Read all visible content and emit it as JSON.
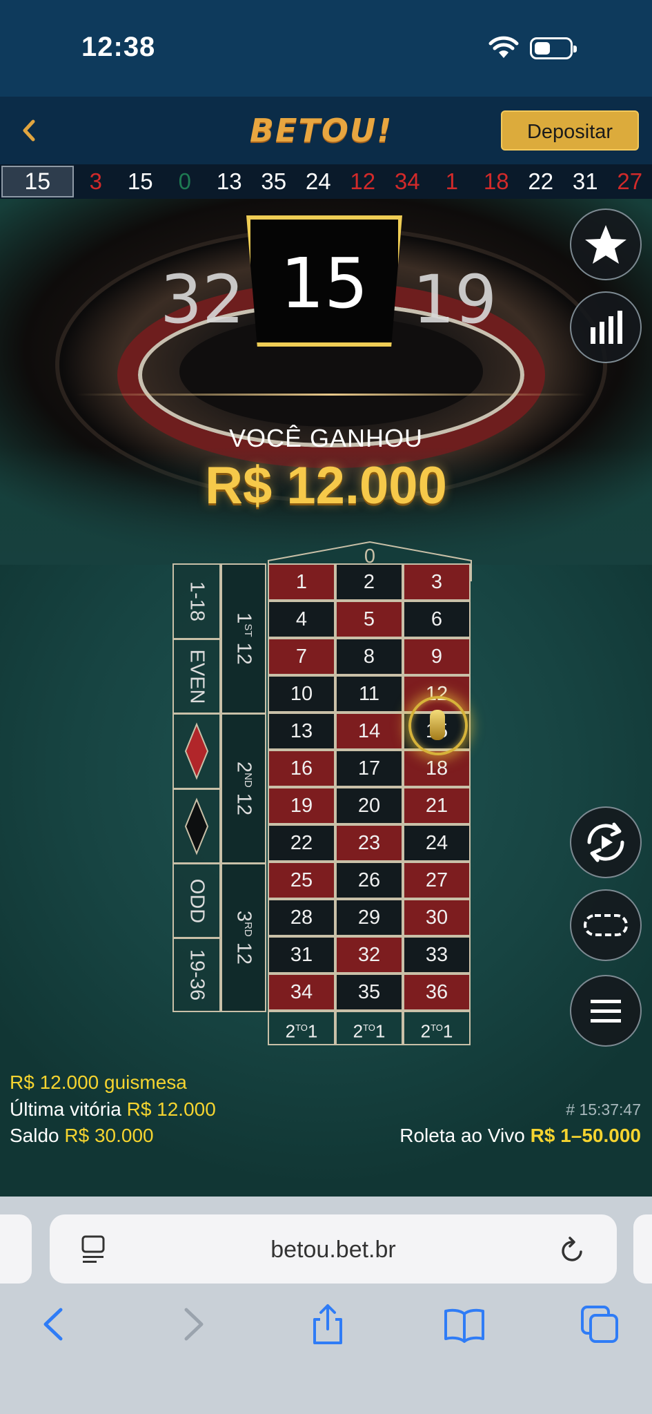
{
  "status_bar": {
    "time": "12:38"
  },
  "header": {
    "logo": "BETOU!",
    "deposit_label": "Depositar"
  },
  "history": {
    "current": "15",
    "numbers": [
      {
        "n": "3",
        "color": "#d22a2a"
      },
      {
        "n": "15",
        "color": "#ffffff"
      },
      {
        "n": "0",
        "color": "#1e7a52"
      },
      {
        "n": "13",
        "color": "#ffffff"
      },
      {
        "n": "35",
        "color": "#ffffff"
      },
      {
        "n": "24",
        "color": "#ffffff"
      },
      {
        "n": "12",
        "color": "#d22a2a"
      },
      {
        "n": "34",
        "color": "#d22a2a"
      },
      {
        "n": "1",
        "color": "#d22a2a"
      },
      {
        "n": "18",
        "color": "#d22a2a"
      },
      {
        "n": "22",
        "color": "#ffffff"
      },
      {
        "n": "31",
        "color": "#ffffff"
      },
      {
        "n": "27",
        "color": "#d22a2a"
      }
    ]
  },
  "result": {
    "left": "32",
    "winning": "15",
    "right": "19",
    "label": "VOCÊ GANHOU",
    "amount": "R$ 12.000"
  },
  "table": {
    "zero": "0",
    "rows": [
      [
        "1",
        "2",
        "3"
      ],
      [
        "4",
        "5",
        "6"
      ],
      [
        "7",
        "8",
        "9"
      ],
      [
        "10",
        "11",
        "12"
      ],
      [
        "13",
        "14",
        "15"
      ],
      [
        "16",
        "17",
        "18"
      ],
      [
        "19",
        "20",
        "21"
      ],
      [
        "22",
        "23",
        "24"
      ],
      [
        "25",
        "26",
        "27"
      ],
      [
        "28",
        "29",
        "30"
      ],
      [
        "31",
        "32",
        "33"
      ],
      [
        "34",
        "35",
        "36"
      ]
    ],
    "reds": [
      "1",
      "3",
      "5",
      "7",
      "9",
      "12",
      "14",
      "16",
      "18",
      "19",
      "21",
      "23",
      "25",
      "27",
      "30",
      "32",
      "34",
      "36"
    ],
    "column_bets": [
      "2TO1",
      "2TO1",
      "2TO1"
    ],
    "outside": {
      "low": "1-18",
      "even": "EVEN",
      "odd": "ODD",
      "high": "19-36"
    },
    "dozens": [
      {
        "main": "1",
        "sup": "ST",
        "tail": "12"
      },
      {
        "main": "2",
        "sup": "ND",
        "tail": "12"
      },
      {
        "main": "3",
        "sup": "RD",
        "tail": "12"
      }
    ],
    "chip_on": "15"
  },
  "info": {
    "last_bet_amount": "R$ 12.000",
    "last_bet_user": "guismesa",
    "last_win_label": "Última vitória",
    "last_win_value": "R$ 12.000",
    "balance_label": "Saldo",
    "balance_value": "R$ 30.000",
    "round_id": "# 15:37:47",
    "table_name": "Roleta ao Vivo",
    "limits": "R$ 1–50.000"
  },
  "browser": {
    "url": "betou.bet.br"
  },
  "colors": {
    "accent": "#f5d430",
    "deposit": "#dcab3c",
    "red_cell": "#7d1d1f",
    "black_cell": "#121a1e"
  }
}
